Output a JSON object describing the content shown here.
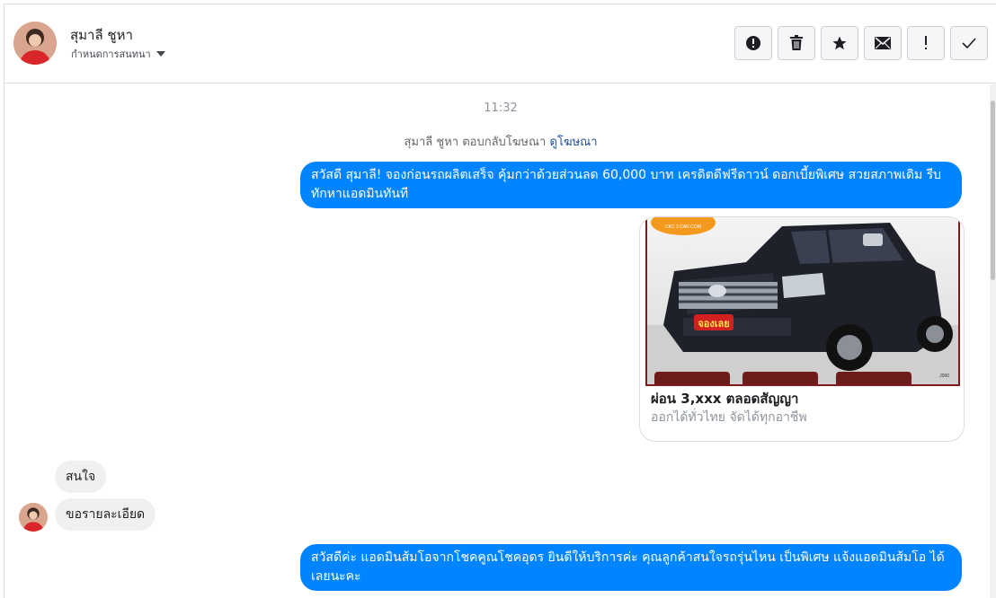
{
  "header": {
    "contact_name": "สุมาลี ชูหา",
    "assign_label": "กำหนดการสนทนา",
    "actions": [
      {
        "icon": "alert-circle-icon",
        "glyph": "!"
      },
      {
        "icon": "trash-icon",
        "glyph": ""
      },
      {
        "icon": "star-icon",
        "glyph": "★"
      },
      {
        "icon": "envelope-icon",
        "glyph": "✉"
      },
      {
        "icon": "exclamation-icon",
        "glyph": "!"
      },
      {
        "icon": "checkmark-icon",
        "glyph": "✓"
      }
    ]
  },
  "conversation": {
    "timestamp": "11:32",
    "ad_reply_text": "สุมาลี ชูหา ตอบกลับโฆษณา",
    "ad_reply_link": "ดูโฆษณา",
    "messages": [
      {
        "direction": "outgoing",
        "text": "สวัสดี สุมาลี! จองก่อนรถผลิตเสร็จ คุ้มกว่าด้วยส่วนลด 60,000 บาท เครดิตดีฟรีดาวน์ ดอกเบี้ยพิเศษ สวยสภาพเดิม รีบทักหาแอดมินทันที"
      },
      {
        "direction": "incoming",
        "text": "สนใจ"
      },
      {
        "direction": "incoming",
        "text": "ขอรายละเอียด"
      },
      {
        "direction": "outgoing",
        "text": "สวัสดีค่ะ แอดมินส้มโอจากโชคคูณโชคอุดร ยินดีให้บริการค่ะ   คุณลูกค้าสนใจรถรุ่นไหน เป็นพิเศษ แจ้งแอดมินส้มโอ ได้เลยนะคะ"
      }
    ],
    "ad_card": {
      "logo_text": "CKC 2 CAR.COM",
      "badge_text": "จองเลย",
      "title": "ผ่อน 3,xxx ตลอดสัญญา",
      "subtitle": "ออกได้ทั่วไทย จัดได้ทุกอาชีพ"
    }
  },
  "colors": {
    "outgoing_bubble": "#0084ff",
    "incoming_bubble": "#f1f0f0",
    "link": "#1c4d9c"
  }
}
